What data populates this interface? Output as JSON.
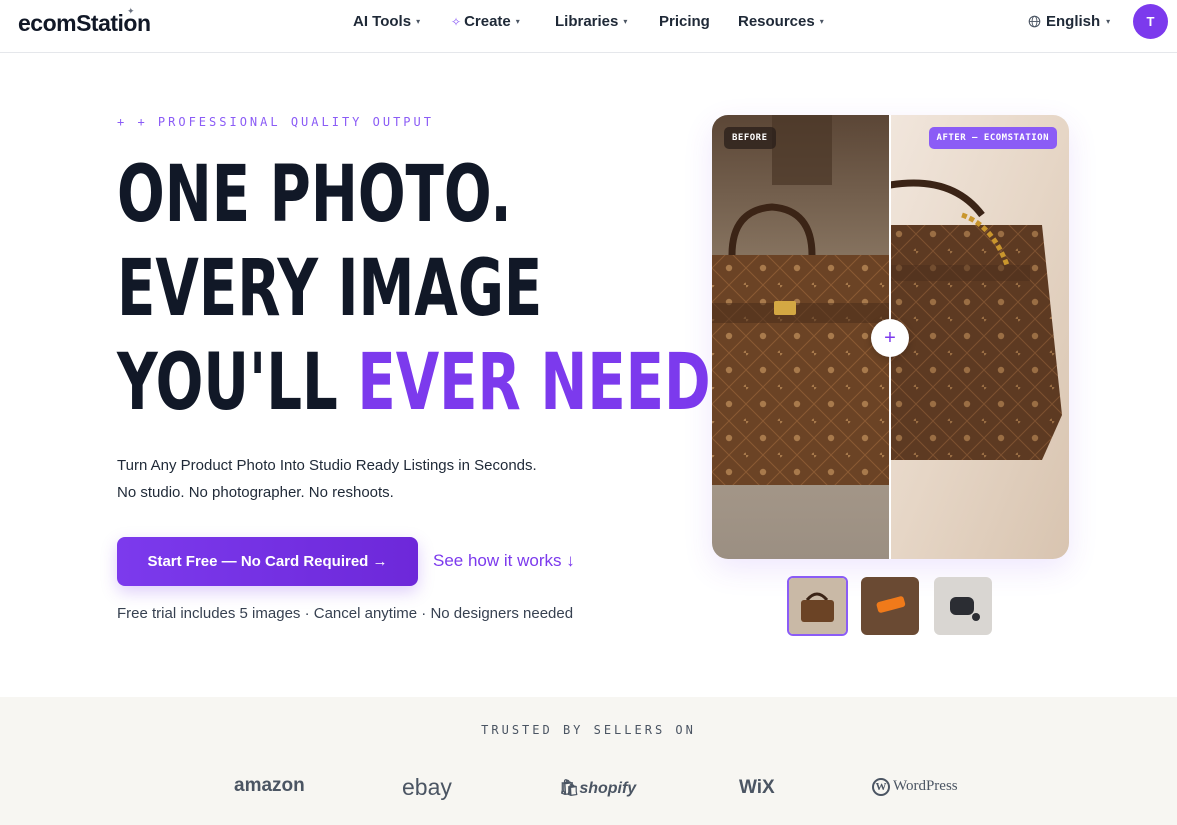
{
  "nav": {
    "logo": "ecomStation",
    "menu": [
      {
        "label": "AI Tools"
      },
      {
        "label": "Create"
      },
      {
        "label": "Libraries"
      },
      {
        "label": "Pricing"
      },
      {
        "label": "Resources"
      }
    ],
    "language": "English",
    "avatar_initial": "T"
  },
  "hero": {
    "eyebrow": "+ + PROFESSIONAL QUALITY OUTPUT",
    "headline_line1": "ONE PHOTO.",
    "headline_line2": "EVERY IMAGE",
    "headline_line3_plain": "YOU'LL ",
    "headline_line3_accent": "EVER NEED.",
    "subtitle_line1": "Turn Any Product Photo Into Studio Ready Listings in Seconds.",
    "subtitle_line2": "No studio. No photographer. No reshoots.",
    "cta_label": "Start Free — No Card Required →",
    "secondary_link": "See how it works ↓",
    "fineprint": "Free trial includes 5 images · Cancel anytime · No designers needed"
  },
  "comparison": {
    "before_tag": "BEFORE",
    "after_tag": "AFTER — ECOMSTATION",
    "handle_icon": "+"
  },
  "trusted": {
    "label": "TRUSTED BY SELLERS ON",
    "brands": [
      "amazon",
      "ebay",
      "shopify",
      "WiX",
      "WordPress"
    ]
  },
  "colors": {
    "accent": "#7c3aed",
    "accent_light": "#8b5cf6",
    "text_dark": "#111827",
    "trusted_bg": "#f7f6f2"
  }
}
